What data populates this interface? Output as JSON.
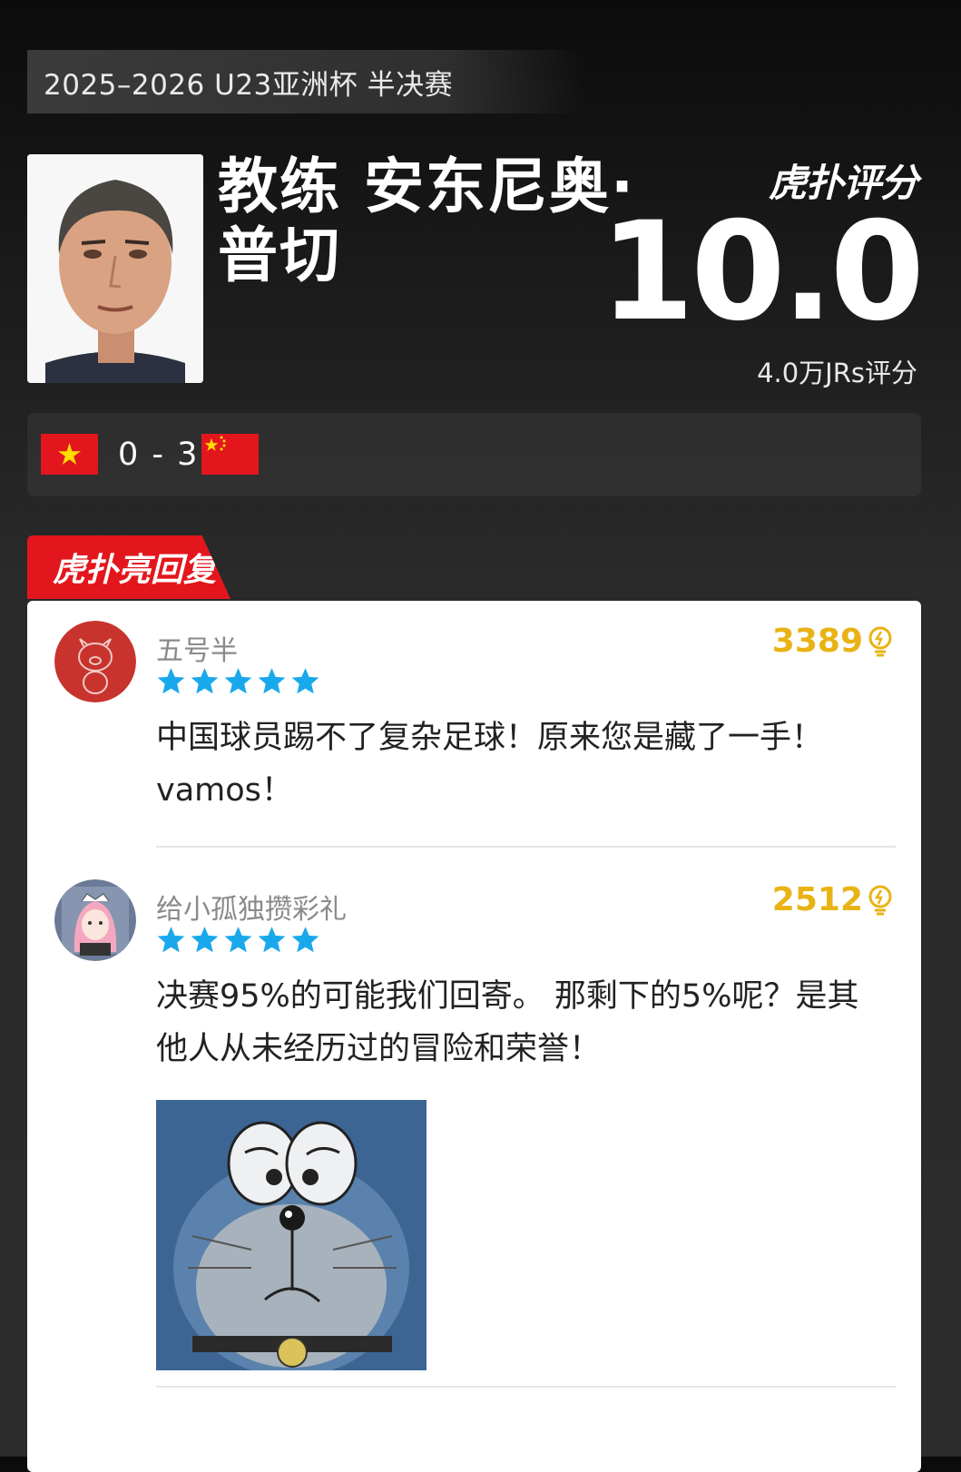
{
  "header": {
    "competition": "2025–2026 U23亚洲杯 半决赛",
    "coach_name": "教练 安东尼奥·普切",
    "brand_label": "虎扑评分",
    "score": "10.0",
    "rating_count": "4.0万JRs评分"
  },
  "match": {
    "score": "0 - 3",
    "home_flag": "vietnam-flag",
    "away_flag": "china-flag"
  },
  "section": {
    "label": "虎扑亮回复"
  },
  "comments": [
    {
      "username": "五号半",
      "stars": 5,
      "likes": "3389",
      "text": "中国球员踢不了复杂足球！原来您是藏了一手！vamos！"
    },
    {
      "username": "给小孤独攒彩礼",
      "stars": 5,
      "likes": "2512",
      "text": "决赛95%的可能我们回寄。 那剩下的5%呢？是其他人从未经历过的冒险和荣誉！"
    }
  ],
  "colors": {
    "accent_red": "#e4161d",
    "star_blue": "#1aa8ec",
    "likes_gold": "#e9b315"
  }
}
